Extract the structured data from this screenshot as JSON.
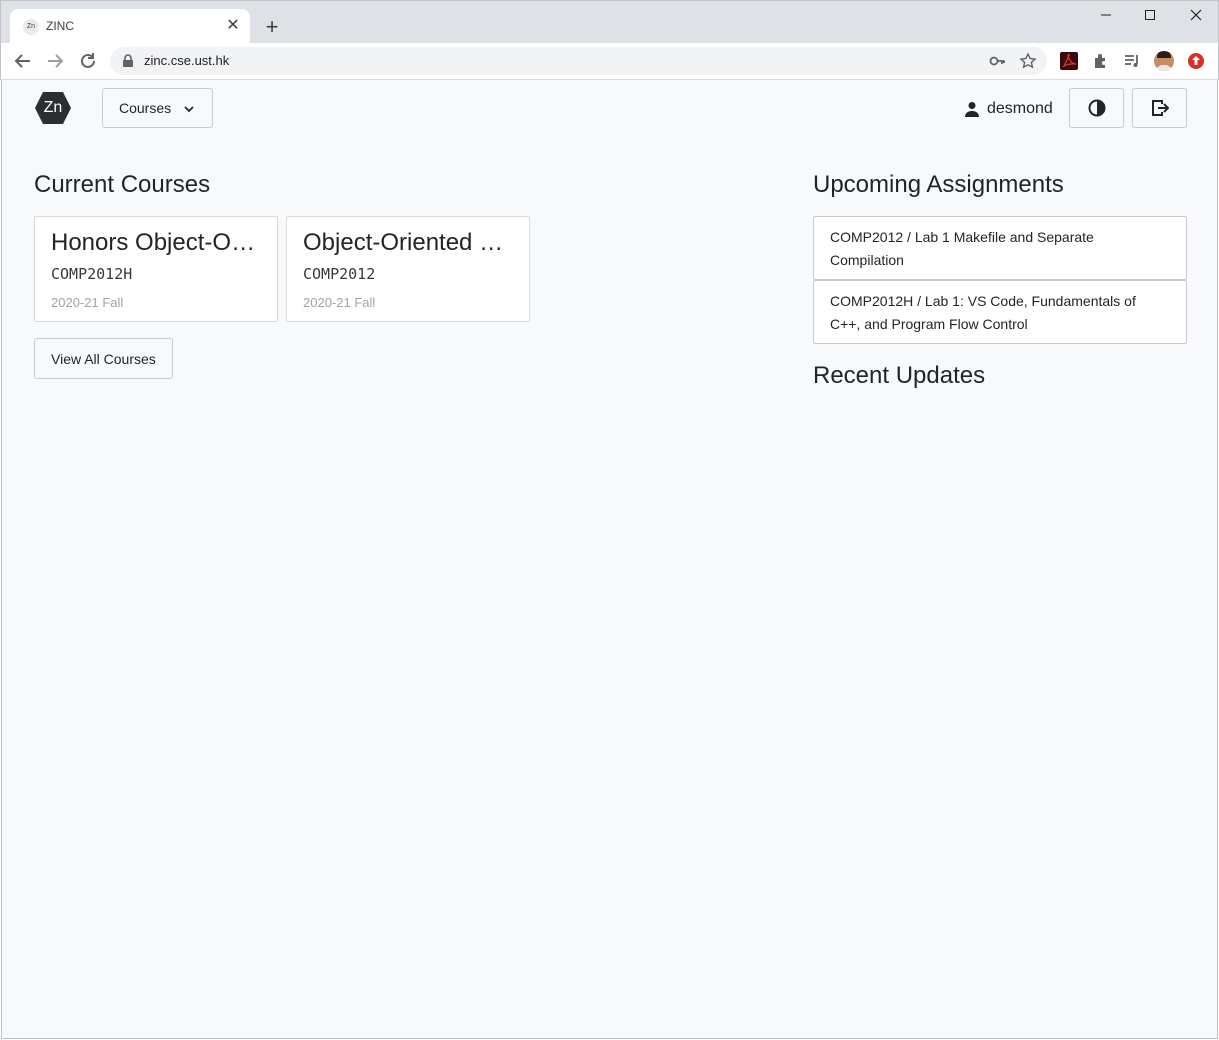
{
  "browser": {
    "tab_title": "ZINC",
    "favicon_text": "Zn",
    "url": "zinc.cse.ust.hk",
    "icons": [
      "back-arrow-icon",
      "forward-arrow-icon",
      "reload-icon",
      "lock-icon",
      "key-icon",
      "star-icon",
      "pdf-extension-icon",
      "extensions-puzzle-icon",
      "reading-list-icon",
      "profile-avatar-icon",
      "update-icon"
    ]
  },
  "header": {
    "logo_text": "Zn",
    "courses_label": "Courses",
    "username": "desmond"
  },
  "current_courses": {
    "heading": "Current Courses",
    "items": [
      {
        "title": "Honors Object-Oriented Programming",
        "code": "COMP2012H",
        "term": "2020-21 Fall"
      },
      {
        "title": "Object-Oriented Programming and Data Structures",
        "code": "COMP2012",
        "term": "2020-21 Fall"
      }
    ],
    "view_all_label": "View All Courses"
  },
  "upcoming": {
    "heading": "Upcoming Assignments",
    "items": [
      {
        "label": "COMP2012 / Lab 1 Makefile and Separate Compilation"
      },
      {
        "label": "COMP2012H / Lab 1: VS Code, Fundamentals of C++, and Program Flow Control"
      }
    ]
  },
  "recent_updates": {
    "heading": "Recent Updates"
  },
  "colors": {
    "page_bg": "#f8f9fa",
    "text": "#212529",
    "muted": "#a0a4a8",
    "logo_bg": "#2b2f33"
  }
}
